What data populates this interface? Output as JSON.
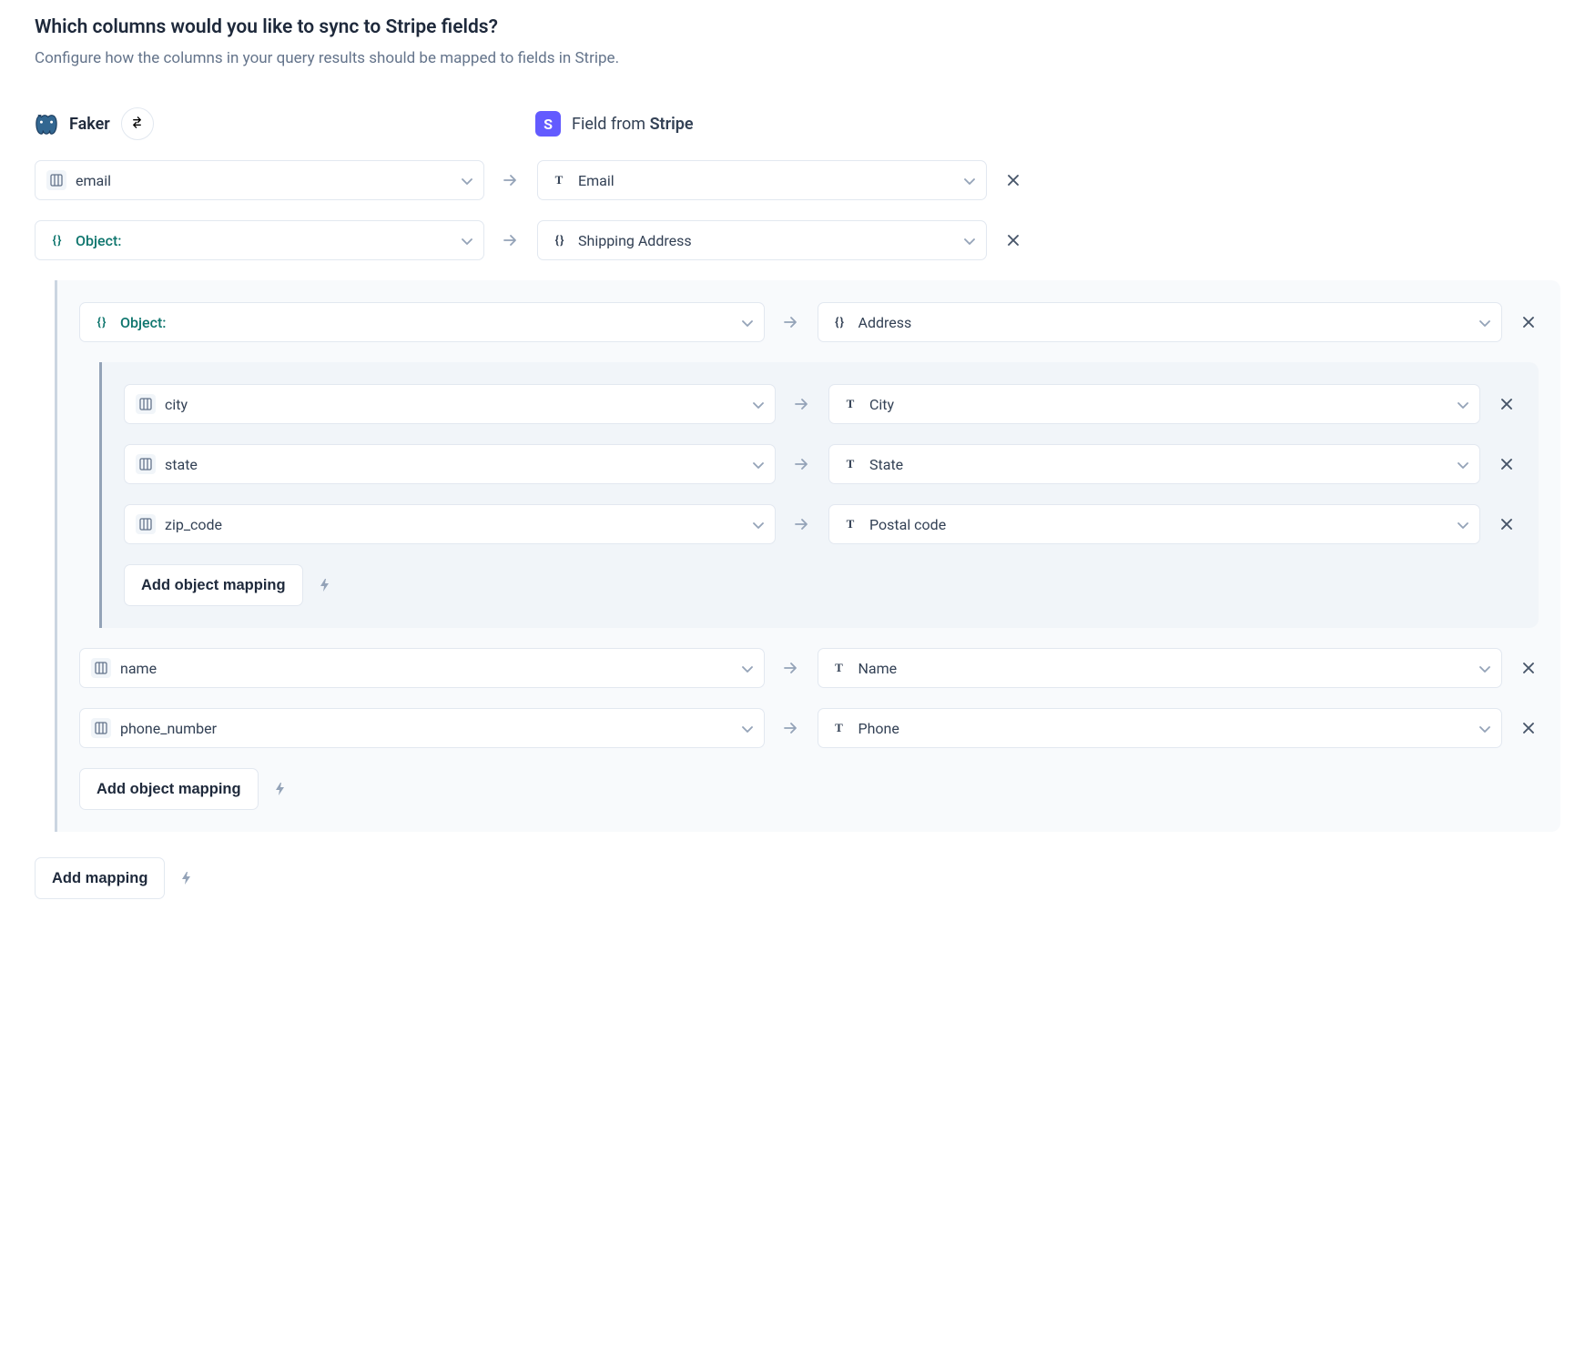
{
  "header": {
    "title": "Which columns would you like to sync to Stripe fields?",
    "subtitle": "Configure how the columns in your query results should be mapped to fields in Stripe."
  },
  "source": {
    "name": "Faker"
  },
  "destination": {
    "prefix": "Field from ",
    "name": "Stripe",
    "badge": "S"
  },
  "rows": {
    "email": {
      "source": "email",
      "dest": "Email"
    },
    "object_root": {
      "source": "Object:",
      "dest": "Shipping Address"
    },
    "object_inner": {
      "source": "Object:",
      "dest": "Address"
    },
    "city": {
      "source": "city",
      "dest": "City"
    },
    "state": {
      "source": "state",
      "dest": "State"
    },
    "zip": {
      "source": "zip_code",
      "dest": "Postal code"
    },
    "name": {
      "source": "name",
      "dest": "Name"
    },
    "phone": {
      "source": "phone_number",
      "dest": "Phone"
    }
  },
  "buttons": {
    "add_object_mapping": "Add object mapping",
    "add_mapping": "Add mapping"
  }
}
